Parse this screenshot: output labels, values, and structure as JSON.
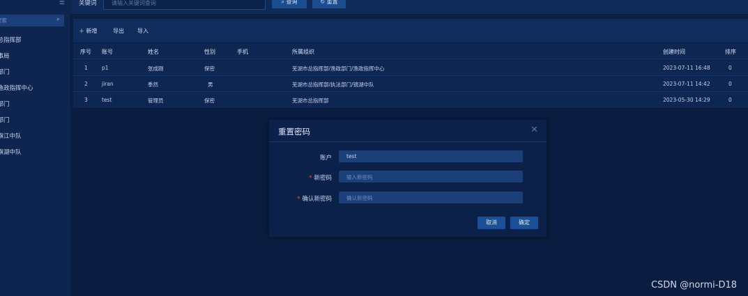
{
  "sidebar": {
    "menu_icon": "hamburger-icon",
    "search_placeholder": "搜索",
    "tree": [
      "市总指挥部",
      "行事局",
      "政部门",
      "、渔政指挥中心",
      "利部门",
      "法部门",
      "、旗江中队",
      "、旗湖中队"
    ]
  },
  "topbar": {
    "keyword_label": "关键词",
    "keyword_placeholder": "请输入关键词查询",
    "query_label": "查询",
    "reset_label": "重置"
  },
  "toolbar": {
    "add_label": "新增",
    "export_label": "导出",
    "import_label": "导入"
  },
  "table": {
    "headers": {
      "seq": "序号",
      "account": "账号",
      "name": "姓名",
      "gender": "性别",
      "phone": "手机",
      "org": "所属组织",
      "created": "创建时间",
      "order": "排序"
    },
    "rows": [
      {
        "seq": "1",
        "account": "p1",
        "name": "张成刚",
        "gender": "保密",
        "phone": "",
        "org": "芜湖市总指挥部/渔政部门/渔政指挥中心",
        "created": "2023-07-11 16:48",
        "order": "0"
      },
      {
        "seq": "2",
        "account": "jiran",
        "name": "季然",
        "gender": "男",
        "phone": "",
        "org": "芜湖市总指挥部/执法部门/镜湖中队",
        "created": "2023-07-11 14:42",
        "order": "0"
      },
      {
        "seq": "3",
        "account": "test",
        "name": "管理员",
        "gender": "保密",
        "phone": "",
        "org": "芜湖市总指挥部",
        "created": "2023-05-30 14:29",
        "order": "0"
      }
    ]
  },
  "dialog": {
    "title": "重置密码",
    "account_label": "账户",
    "account_value": "test",
    "new_password_label": "新密码",
    "new_password_placeholder": "输入新密码",
    "confirm_password_label": "确认新密码",
    "confirm_password_placeholder": "确认新密码",
    "required_mark": "*",
    "cancel_label": "取消",
    "ok_label": "确定"
  },
  "watermark": "CSDN @normi-D18"
}
